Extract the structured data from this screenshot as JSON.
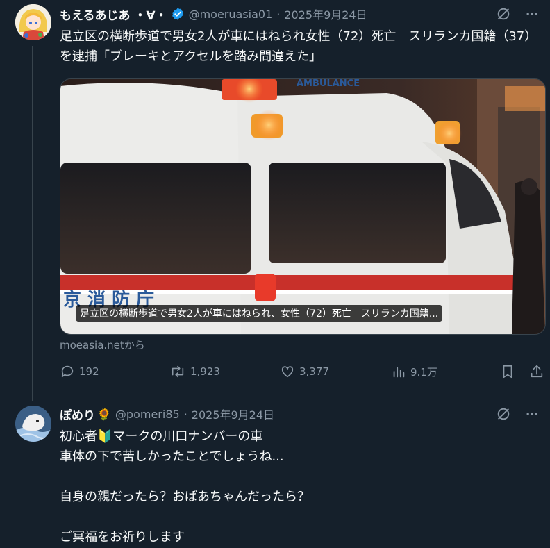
{
  "tweet1": {
    "author_name": "もえるあじあ ・∀・",
    "handle": "@moeruasia01",
    "separator": "·",
    "date": "2025年9月24日",
    "text": "足立区の横断歩道で男女2人が車にはねられ女性（72）死亡　スリランカ国籍（37）を逮捕「ブレーキとアクセルを踏み間違えた」",
    "card": {
      "caption": "足立区の横断歩道で男女2人が車にはねられ、女性（72）死亡　スリランカ国籍...",
      "ambulance_text": "AMBULANCE",
      "side_text": "京 消 防 庁"
    },
    "source": "moeasia.netから",
    "stats": {
      "replies": "192",
      "reposts": "1,923",
      "likes": "3,377",
      "views": "9.1万"
    }
  },
  "tweet2": {
    "author_name": "ぽめり",
    "handle": "@pomeri85",
    "separator": "·",
    "date": "2025年9月24日",
    "text": "初心者🔰マークの川口ナンバーの車\n車体の下で苦しかったことでしょうね...\n\n自身の親だったら？おばあちゃんだったら？\n\nご冥福をお祈りします"
  },
  "icons": {
    "verified": "verified-badge-icon",
    "grok": "grok-icon",
    "more": "more-icon",
    "reply": "reply-icon",
    "repost": "repost-icon",
    "like": "like-icon",
    "views": "views-icon",
    "bookmark": "bookmark-icon",
    "share": "share-icon",
    "flower": "sunflower-icon"
  },
  "colors": {
    "background": "#15202b",
    "text": "#f7f9f9",
    "muted": "#8b98a5",
    "accent": "#1d9bf0",
    "divider": "#38444d"
  }
}
